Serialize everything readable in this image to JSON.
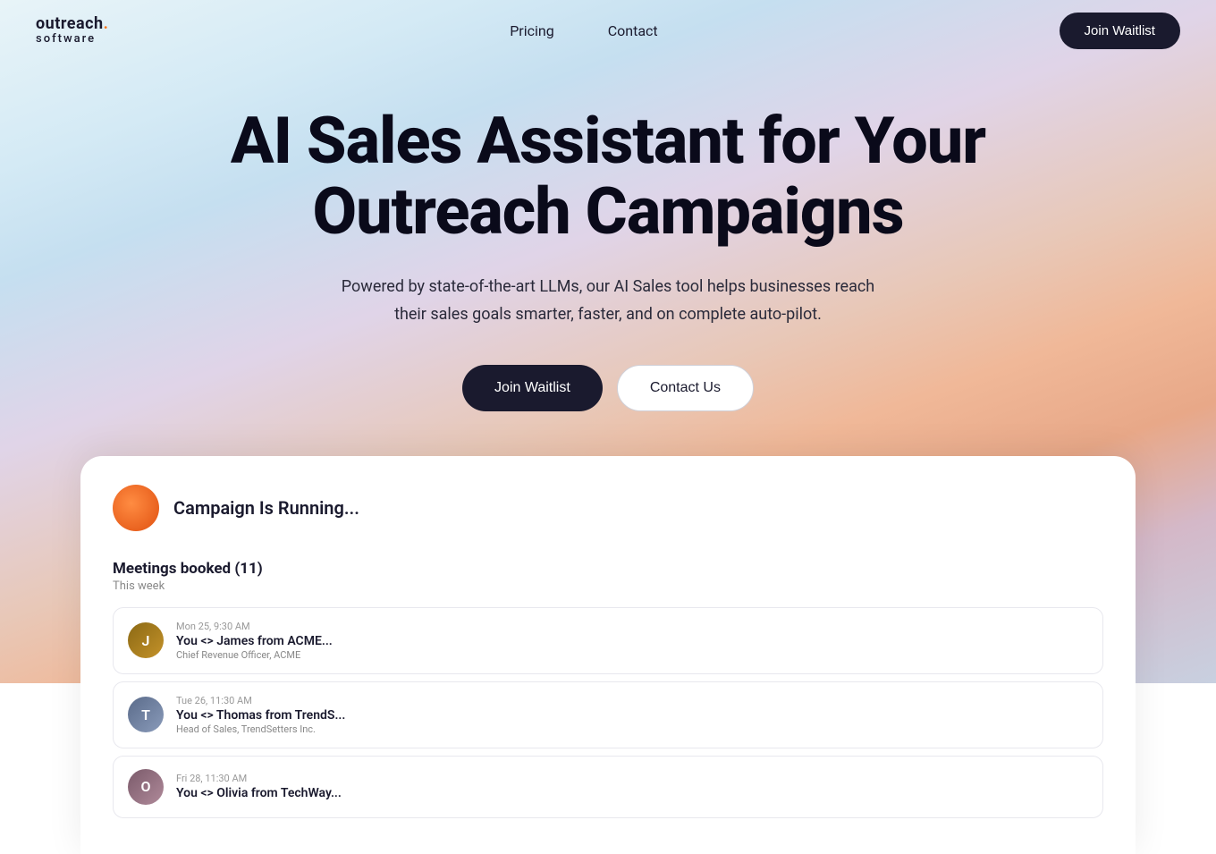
{
  "brand": {
    "name": "outreach.",
    "suffix": "software"
  },
  "nav": {
    "links": [
      {
        "label": "Pricing",
        "id": "pricing"
      },
      {
        "label": "Contact",
        "id": "contact"
      }
    ],
    "cta": "Join Waitlist"
  },
  "hero": {
    "title": "AI Sales Assistant for Your Outreach Campaigns",
    "subtitle": "Powered by state-of-the-art LLMs, our AI Sales tool helps businesses reach their sales goals smarter, faster, and on complete auto-pilot.",
    "btn_primary": "Join Waitlist",
    "btn_secondary": "Contact Us"
  },
  "campaign": {
    "status": "Campaign Is Running...",
    "meetings_label": "Meetings booked (11)",
    "week_label": "This week",
    "meetings": [
      {
        "time": "Mon 25, 9:30 AM",
        "name": "You <> James from ACME...",
        "role": "Chief Revenue Officer, ACME",
        "initials": "J"
      },
      {
        "time": "Tue 26, 11:30 AM",
        "name": "You <> Thomas from TrendS...",
        "role": "Head of Sales, TrendSetters Inc.",
        "initials": "T"
      },
      {
        "time": "Fri 28, 11:30 AM",
        "name": "You <> Olivia from TechWay...",
        "role": "",
        "initials": "O"
      }
    ]
  }
}
